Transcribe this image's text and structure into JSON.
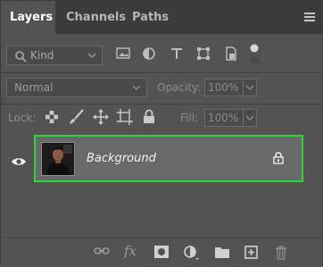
{
  "tabs": [
    {
      "label": "Layers",
      "active": true
    },
    {
      "label": "Channels",
      "active": false
    },
    {
      "label": "Paths",
      "active": false
    }
  ],
  "filter": {
    "kind_label": "Kind",
    "icons": [
      "image-filter-icon",
      "adjustment-filter-icon",
      "type-filter-icon",
      "shape-filter-icon",
      "smart-object-filter-icon",
      "filter-toggle-icon"
    ]
  },
  "blend": {
    "mode": "Normal",
    "opacity_label": "Opacity:",
    "opacity_value": "100%"
  },
  "lock": {
    "label": "Lock:",
    "icons": [
      "lock-transparent-pixels-icon",
      "lock-image-pixels-icon",
      "lock-position-icon",
      "lock-artboard-icon",
      "lock-all-icon"
    ],
    "fill_label": "Fill:",
    "fill_value": "100%"
  },
  "layers": [
    {
      "name": "Background",
      "visible": true,
      "locked": true,
      "selected": true
    }
  ],
  "bottom_toolbar": {
    "fx_label": "fx",
    "icons": [
      "link-layers-icon",
      "fx-icon",
      "add-mask-icon",
      "adjustment-layer-icon",
      "new-group-icon",
      "new-layer-icon",
      "delete-icon"
    ]
  },
  "colors": {
    "panel_bg": "#535353",
    "tab_bar_bg": "#3b3b3b",
    "selected_layer_bg": "#696969",
    "highlight_outline": "#2fd435"
  }
}
